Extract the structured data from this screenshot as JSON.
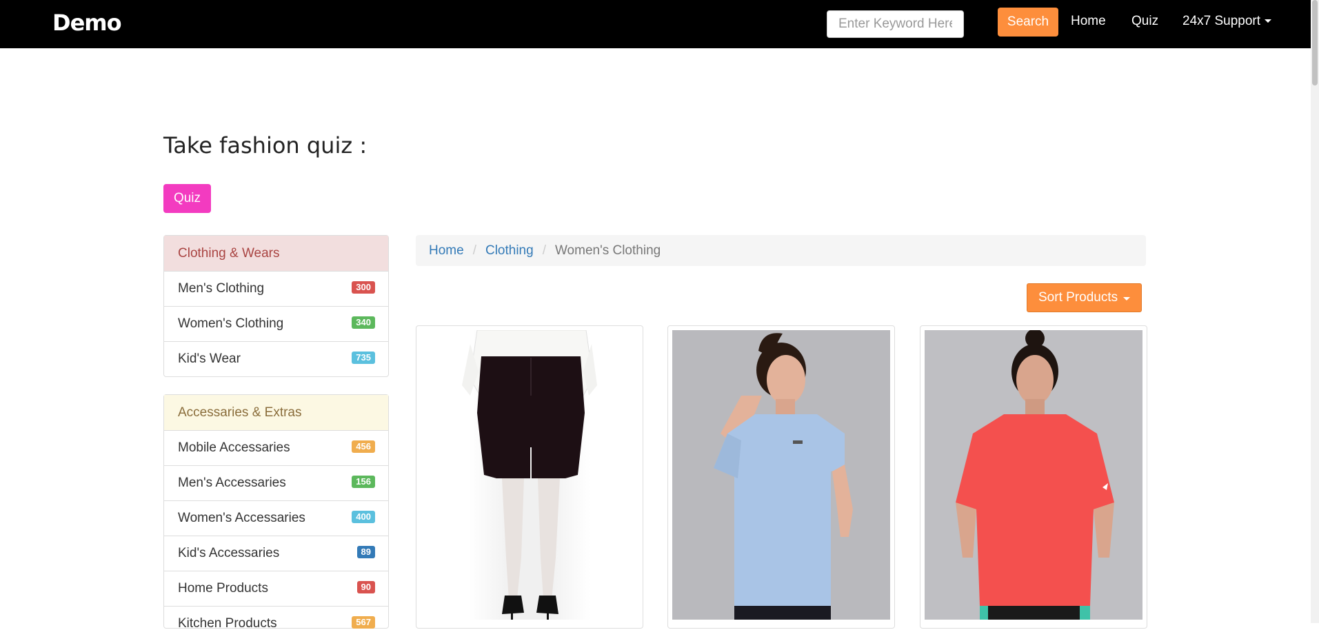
{
  "navbar": {
    "brand": "Demo",
    "search_placeholder": "Enter Keyword Here ...",
    "search_button": "Search",
    "links": [
      "Home",
      "Quiz",
      "24x7 Support"
    ]
  },
  "quiz": {
    "title": "Take fashion quiz :",
    "button": "Quiz"
  },
  "sidebar": {
    "clothing": {
      "heading": "Clothing & Wears",
      "items": [
        {
          "label": "Men's Clothing",
          "count": "300",
          "color": "#d9534f"
        },
        {
          "label": "Women's Clothing",
          "count": "340",
          "color": "#5cb85c"
        },
        {
          "label": "Kid's Wear",
          "count": "735",
          "color": "#5bc0de"
        }
      ]
    },
    "accessories": {
      "heading": "Accessaries & Extras",
      "items": [
        {
          "label": "Mobile Accessaries",
          "count": "456",
          "color": "#f0ad4e"
        },
        {
          "label": "Men's Accessaries",
          "count": "156",
          "color": "#5cb85c"
        },
        {
          "label": "Women's Accessaries",
          "count": "400",
          "color": "#5bc0de"
        },
        {
          "label": "Kid's Accessaries",
          "count": "89",
          "color": "#337ab7"
        },
        {
          "label": "Home Products",
          "count": "90",
          "color": "#d9534f"
        },
        {
          "label": "Kitchen Products",
          "count": "567",
          "color": "#f0ad4e"
        }
      ]
    }
  },
  "breadcrumb": {
    "items": [
      "Home",
      "Clothing"
    ],
    "active": "Women's Clothing"
  },
  "sort": {
    "label": "Sort Products"
  },
  "colors": {
    "accent_orange": "#fd8e3c",
    "quiz_pink": "#f33bc0"
  }
}
